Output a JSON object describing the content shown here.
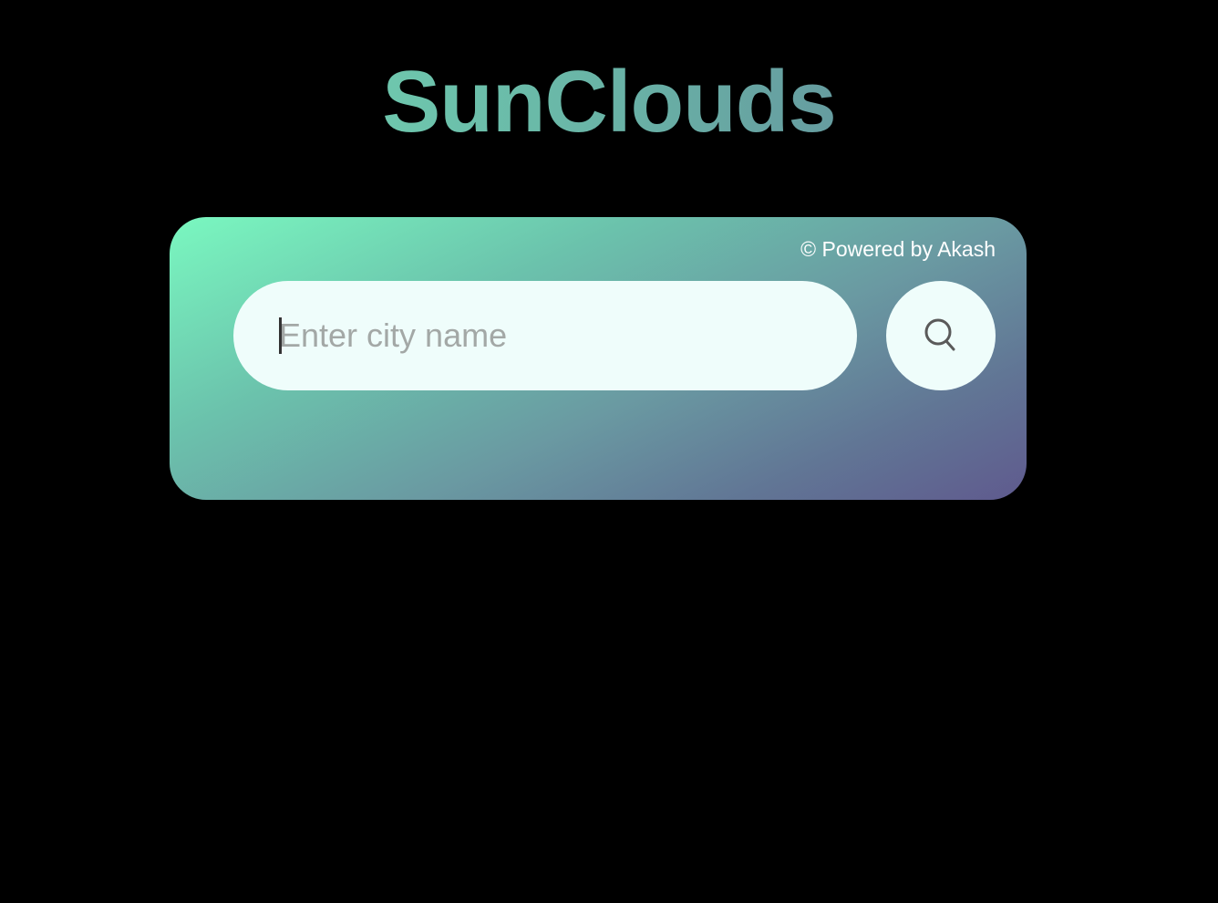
{
  "header": {
    "title": "SunClouds"
  },
  "card": {
    "powered_by": "© Powered by Akash",
    "search": {
      "placeholder": "Enter city name",
      "value": ""
    },
    "search_button_icon": "search-icon"
  },
  "colors": {
    "background": "#000000",
    "gradient_start": "#7af8c0",
    "gradient_end": "#5f5a8e",
    "input_background": "#effdfb"
  }
}
